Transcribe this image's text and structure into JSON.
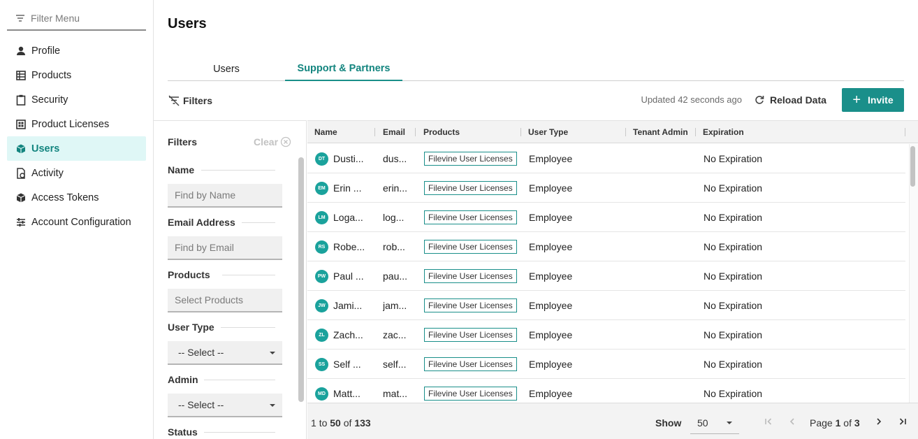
{
  "nav": {
    "filter_placeholder": "Filter Menu",
    "items": [
      {
        "label": "Profile",
        "icon": "person-icon"
      },
      {
        "label": "Products",
        "icon": "grid-icon"
      },
      {
        "label": "Security",
        "icon": "clipboard-icon"
      },
      {
        "label": "Product Licenses",
        "icon": "license-icon"
      },
      {
        "label": "Users",
        "icon": "cube-icon",
        "active": true
      },
      {
        "label": "Activity",
        "icon": "activity-icon"
      },
      {
        "label": "Access Tokens",
        "icon": "cube-outline-icon"
      },
      {
        "label": "Account Configuration",
        "icon": "sliders-icon"
      }
    ]
  },
  "header": {
    "title": "Users",
    "tabs": [
      {
        "label": "Users"
      },
      {
        "label": "Support & Partners",
        "active": true
      }
    ]
  },
  "toolbar": {
    "filters_label": "Filters",
    "updated_text": "Updated 42 seconds ago",
    "reload_label": "Reload Data",
    "invite_label": "Invite"
  },
  "filters": {
    "title": "Filters",
    "clear_label": "Clear",
    "name_label": "Name",
    "name_placeholder": "Find by Name",
    "email_label": "Email Address",
    "email_placeholder": "Find by Email",
    "products_label": "Products",
    "products_placeholder": "Select Products",
    "user_type_label": "User Type",
    "user_type_value": "-- Select --",
    "admin_label": "Admin",
    "admin_value": "-- Select --",
    "status_label": "Status"
  },
  "table": {
    "columns": [
      "Name",
      "Email",
      "Products",
      "User Type",
      "Tenant Admin",
      "Expiration"
    ],
    "rows": [
      {
        "initials": "DT",
        "name": "Dusti...",
        "email": "dus...",
        "product": "Filevine User Licenses",
        "user_type": "Employee",
        "tenant_admin": "",
        "expiration": "No Expiration"
      },
      {
        "initials": "EM",
        "name": "Erin ...",
        "email": "erin...",
        "product": "Filevine User Licenses",
        "user_type": "Employee",
        "tenant_admin": "",
        "expiration": "No Expiration"
      },
      {
        "initials": "LM",
        "name": "Loga...",
        "email": "log...",
        "product": "Filevine User Licenses",
        "user_type": "Employee",
        "tenant_admin": "",
        "expiration": "No Expiration"
      },
      {
        "initials": "RS",
        "name": "Robe...",
        "email": "rob...",
        "product": "Filevine User Licenses",
        "user_type": "Employee",
        "tenant_admin": "",
        "expiration": "No Expiration"
      },
      {
        "initials": "PW",
        "name": "Paul ...",
        "email": "pau...",
        "product": "Filevine User Licenses",
        "user_type": "Employee",
        "tenant_admin": "",
        "expiration": "No Expiration"
      },
      {
        "initials": "JW",
        "name": "Jami...",
        "email": "jam...",
        "product": "Filevine User Licenses",
        "user_type": "Employee",
        "tenant_admin": "",
        "expiration": "No Expiration"
      },
      {
        "initials": "ZL",
        "name": "Zach...",
        "email": "zac...",
        "product": "Filevine User Licenses",
        "user_type": "Employee",
        "tenant_admin": "",
        "expiration": "No Expiration"
      },
      {
        "initials": "SS",
        "name": "Self ...",
        "email": "self...",
        "product": "Filevine User Licenses",
        "user_type": "Employee",
        "tenant_admin": "",
        "expiration": "No Expiration"
      },
      {
        "initials": "MD",
        "name": "Matt...",
        "email": "mat...",
        "product": "Filevine User Licenses",
        "user_type": "Employee",
        "tenant_admin": "",
        "expiration": "No Expiration"
      }
    ]
  },
  "pagination": {
    "range_start": "1",
    "range_to": "to",
    "range_end": "50",
    "range_of": "of",
    "total": "133",
    "show_label": "Show",
    "page_size": "50",
    "page_word": "Page",
    "current_page": "1",
    "of_word": "of",
    "total_pages": "3"
  },
  "colors": {
    "accent": "#1a8f8a",
    "accent_light": "#dff7f6",
    "avatar": "#1aa29c"
  }
}
